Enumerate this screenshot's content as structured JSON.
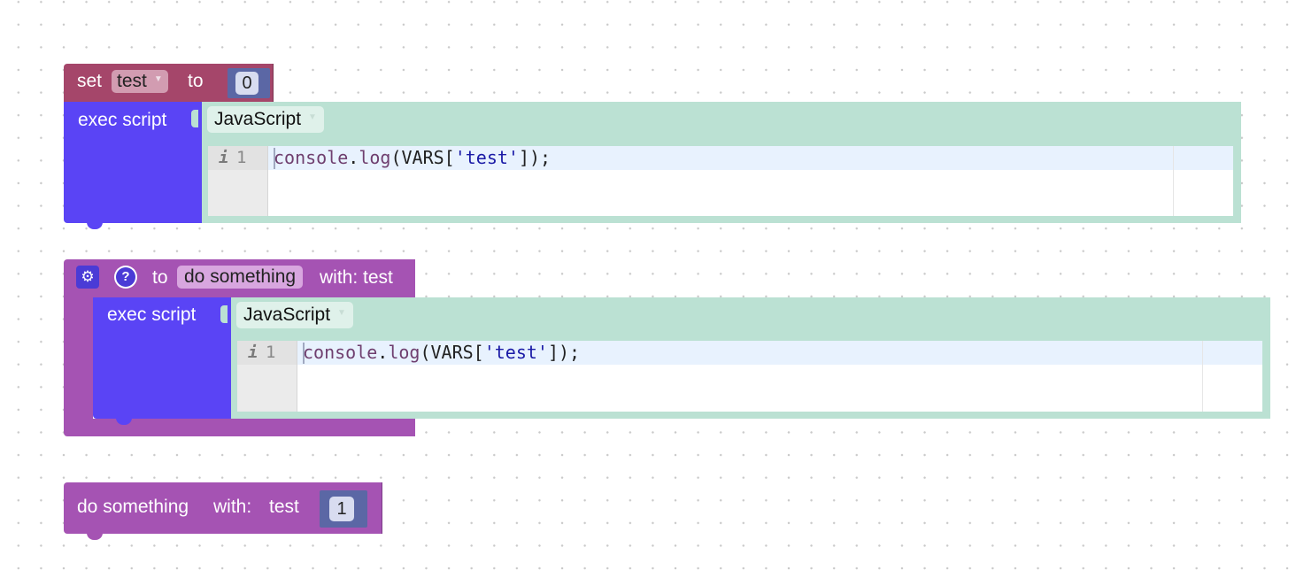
{
  "set_block": {
    "set_label": "set",
    "variable": "test",
    "to_label": "to",
    "value": "0"
  },
  "exec_blocks": [
    {
      "label": "exec script",
      "language": "JavaScript",
      "line_number": "1",
      "code_tokens": {
        "ident1": "console",
        "dot": ".",
        "ident2": "log",
        "open": "(VARS[",
        "str": "'test'",
        "close": "]);"
      }
    },
    {
      "label": "exec script",
      "language": "JavaScript",
      "line_number": "1",
      "code_tokens": {
        "ident1": "console",
        "dot": ".",
        "ident2": "log",
        "open": "(VARS[",
        "str": "'test'",
        "close": "]);"
      }
    }
  ],
  "procedure_def": {
    "to_label": "to",
    "name": "do something",
    "params_label": "with: test"
  },
  "procedure_call": {
    "name": "do something",
    "with_label": "with:",
    "param_name": "test",
    "arg_value": "1"
  },
  "colors": {
    "variables": "#a5466a",
    "math": "#5b67a5",
    "exec": "#5a44f5",
    "code_panel": "#bbe1d3",
    "procedures": "#a553b3"
  },
  "icons": {
    "gear": "gear-icon",
    "help": "help-icon",
    "dropdown": "dropdown-arrow-icon"
  }
}
